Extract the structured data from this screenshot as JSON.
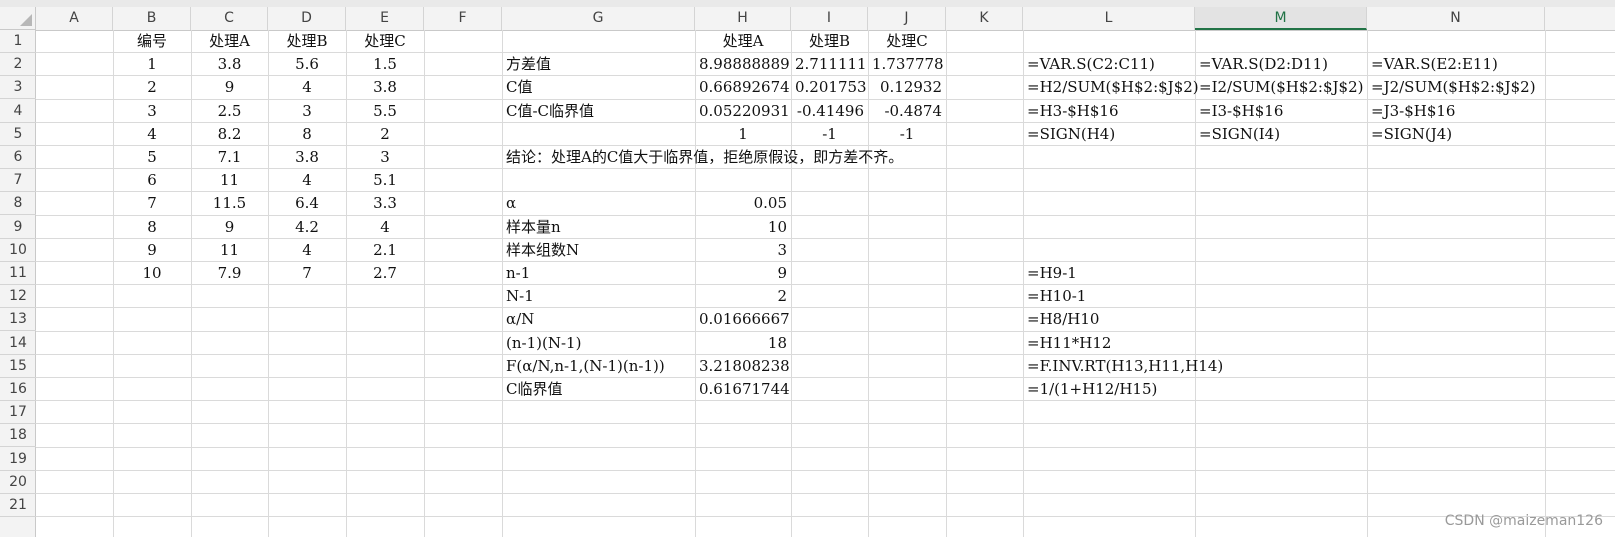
{
  "columns": [
    "A",
    "B",
    "C",
    "D",
    "E",
    "F",
    "G",
    "H",
    "I",
    "J",
    "K",
    "L",
    "M",
    "N"
  ],
  "active_column": "M",
  "rows": [
    "1",
    "2",
    "3",
    "4",
    "5",
    "6",
    "7",
    "8",
    "9",
    "10",
    "11",
    "12",
    "13",
    "14",
    "15",
    "16",
    "17",
    "18",
    "19",
    "20",
    "21"
  ],
  "cells": [
    {
      "ref": "B1",
      "v": "编号",
      "align": "c"
    },
    {
      "ref": "C1",
      "v": "处理A",
      "align": "c"
    },
    {
      "ref": "D1",
      "v": "处理B",
      "align": "c"
    },
    {
      "ref": "E1",
      "v": "处理C",
      "align": "c"
    },
    {
      "ref": "H1",
      "v": "处理A",
      "align": "c"
    },
    {
      "ref": "I1",
      "v": "处理B",
      "align": "c"
    },
    {
      "ref": "J1",
      "v": "处理C",
      "align": "c"
    },
    {
      "ref": "B2",
      "v": "1",
      "align": "c"
    },
    {
      "ref": "C2",
      "v": "3.8",
      "align": "c"
    },
    {
      "ref": "D2",
      "v": "5.6",
      "align": "c"
    },
    {
      "ref": "E2",
      "v": "1.5",
      "align": "c"
    },
    {
      "ref": "G2",
      "v": "方差值",
      "align": "l"
    },
    {
      "ref": "H2",
      "v": "8.98888889",
      "align": "r"
    },
    {
      "ref": "I2",
      "v": "2.711111",
      "align": "r"
    },
    {
      "ref": "J2",
      "v": "1.737778",
      "align": "r"
    },
    {
      "ref": "L2",
      "v": "=VAR.S(C2:C11)",
      "align": "l"
    },
    {
      "ref": "M2",
      "v": "=VAR.S(D2:D11)",
      "align": "l"
    },
    {
      "ref": "N2",
      "v": "=VAR.S(E2:E11)",
      "align": "l"
    },
    {
      "ref": "B3",
      "v": "2",
      "align": "c"
    },
    {
      "ref": "C3",
      "v": "9",
      "align": "c"
    },
    {
      "ref": "D3",
      "v": "4",
      "align": "c"
    },
    {
      "ref": "E3",
      "v": "3.8",
      "align": "c"
    },
    {
      "ref": "G3",
      "v": "C值",
      "align": "l"
    },
    {
      "ref": "H3",
      "v": "0.66892674",
      "align": "r"
    },
    {
      "ref": "I3",
      "v": "0.201753",
      "align": "r"
    },
    {
      "ref": "J3",
      "v": "0.12932",
      "align": "r"
    },
    {
      "ref": "L3",
      "v": "=H2/SUM($H$2:$J$2)",
      "align": "l"
    },
    {
      "ref": "M3",
      "v": "=I2/SUM($H$2:$J$2)",
      "align": "l"
    },
    {
      "ref": "N3",
      "v": "=J2/SUM($H$2:$J$2)",
      "align": "l"
    },
    {
      "ref": "B4",
      "v": "3",
      "align": "c"
    },
    {
      "ref": "C4",
      "v": "2.5",
      "align": "c"
    },
    {
      "ref": "D4",
      "v": "3",
      "align": "c"
    },
    {
      "ref": "E4",
      "v": "5.5",
      "align": "c"
    },
    {
      "ref": "G4",
      "v": "C值-C临界值",
      "align": "l"
    },
    {
      "ref": "H4",
      "v": "0.05220931",
      "align": "r"
    },
    {
      "ref": "I4",
      "v": "-0.41496",
      "align": "r"
    },
    {
      "ref": "J4",
      "v": "-0.4874",
      "align": "r"
    },
    {
      "ref": "L4",
      "v": "=H3-$H$16",
      "align": "l"
    },
    {
      "ref": "M4",
      "v": "=I3-$H$16",
      "align": "l"
    },
    {
      "ref": "N4",
      "v": "=J3-$H$16",
      "align": "l"
    },
    {
      "ref": "B5",
      "v": "4",
      "align": "c"
    },
    {
      "ref": "C5",
      "v": "8.2",
      "align": "c"
    },
    {
      "ref": "D5",
      "v": "8",
      "align": "c"
    },
    {
      "ref": "E5",
      "v": "2",
      "align": "c"
    },
    {
      "ref": "H5",
      "v": "1",
      "align": "c"
    },
    {
      "ref": "I5",
      "v": "-1",
      "align": "c"
    },
    {
      "ref": "J5",
      "v": "-1",
      "align": "c"
    },
    {
      "ref": "L5",
      "v": "=SIGN(H4)",
      "align": "l"
    },
    {
      "ref": "M5",
      "v": "=SIGN(I4)",
      "align": "l"
    },
    {
      "ref": "N5",
      "v": "=SIGN(J4)",
      "align": "l"
    },
    {
      "ref": "B6",
      "v": "5",
      "align": "c"
    },
    {
      "ref": "C6",
      "v": "7.1",
      "align": "c"
    },
    {
      "ref": "D6",
      "v": "3.8",
      "align": "c"
    },
    {
      "ref": "E6",
      "v": "3",
      "align": "c"
    },
    {
      "ref": "G6",
      "v": "结论：处理A的C值大于临界值，拒绝原假设，即方差不齐。",
      "align": "l"
    },
    {
      "ref": "B7",
      "v": "6",
      "align": "c"
    },
    {
      "ref": "C7",
      "v": "11",
      "align": "c"
    },
    {
      "ref": "D7",
      "v": "4",
      "align": "c"
    },
    {
      "ref": "E7",
      "v": "5.1",
      "align": "c"
    },
    {
      "ref": "B8",
      "v": "7",
      "align": "c"
    },
    {
      "ref": "C8",
      "v": "11.5",
      "align": "c"
    },
    {
      "ref": "D8",
      "v": "6.4",
      "align": "c"
    },
    {
      "ref": "E8",
      "v": "3.3",
      "align": "c"
    },
    {
      "ref": "G8",
      "v": "α",
      "align": "l"
    },
    {
      "ref": "H8",
      "v": "0.05",
      "align": "r"
    },
    {
      "ref": "B9",
      "v": "8",
      "align": "c"
    },
    {
      "ref": "C9",
      "v": "9",
      "align": "c"
    },
    {
      "ref": "D9",
      "v": "4.2",
      "align": "c"
    },
    {
      "ref": "E9",
      "v": "4",
      "align": "c"
    },
    {
      "ref": "G9",
      "v": "样本量n",
      "align": "l"
    },
    {
      "ref": "H9",
      "v": "10",
      "align": "r"
    },
    {
      "ref": "B10",
      "v": "9",
      "align": "c"
    },
    {
      "ref": "C10",
      "v": "11",
      "align": "c"
    },
    {
      "ref": "D10",
      "v": "4",
      "align": "c"
    },
    {
      "ref": "E10",
      "v": "2.1",
      "align": "c"
    },
    {
      "ref": "G10",
      "v": "样本组数N",
      "align": "l"
    },
    {
      "ref": "H10",
      "v": "3",
      "align": "r"
    },
    {
      "ref": "B11",
      "v": "10",
      "align": "c"
    },
    {
      "ref": "C11",
      "v": "7.9",
      "align": "c"
    },
    {
      "ref": "D11",
      "v": "7",
      "align": "c"
    },
    {
      "ref": "E11",
      "v": "2.7",
      "align": "c"
    },
    {
      "ref": "G11",
      "v": "n-1",
      "align": "l"
    },
    {
      "ref": "H11",
      "v": "9",
      "align": "r"
    },
    {
      "ref": "L11",
      "v": "=H9-1",
      "align": "l"
    },
    {
      "ref": "G12",
      "v": "N-1",
      "align": "l"
    },
    {
      "ref": "H12",
      "v": "2",
      "align": "r"
    },
    {
      "ref": "L12",
      "v": "=H10-1",
      "align": "l"
    },
    {
      "ref": "G13",
      "v": "α/N",
      "align": "l"
    },
    {
      "ref": "H13",
      "v": "0.01666667",
      "align": "r"
    },
    {
      "ref": "L13",
      "v": "=H8/H10",
      "align": "l"
    },
    {
      "ref": "G14",
      "v": "(n-1)(N-1)",
      "align": "l"
    },
    {
      "ref": "H14",
      "v": "18",
      "align": "r"
    },
    {
      "ref": "L14",
      "v": "=H11*H12",
      "align": "l"
    },
    {
      "ref": "G15",
      "v": "F(α/N,n-1,(N-1)(n-1))",
      "align": "l"
    },
    {
      "ref": "H15",
      "v": "3.21808238",
      "align": "r"
    },
    {
      "ref": "L15",
      "v": "=F.INV.RT(H13,H11,H14)",
      "align": "l"
    },
    {
      "ref": "G16",
      "v": "C临界值",
      "align": "l"
    },
    {
      "ref": "H16",
      "v": "0.61671744",
      "align": "r"
    },
    {
      "ref": "L16",
      "v": "=1/(1+H12/H15)",
      "align": "l"
    }
  ],
  "watermark": "CSDN @maizeman126"
}
